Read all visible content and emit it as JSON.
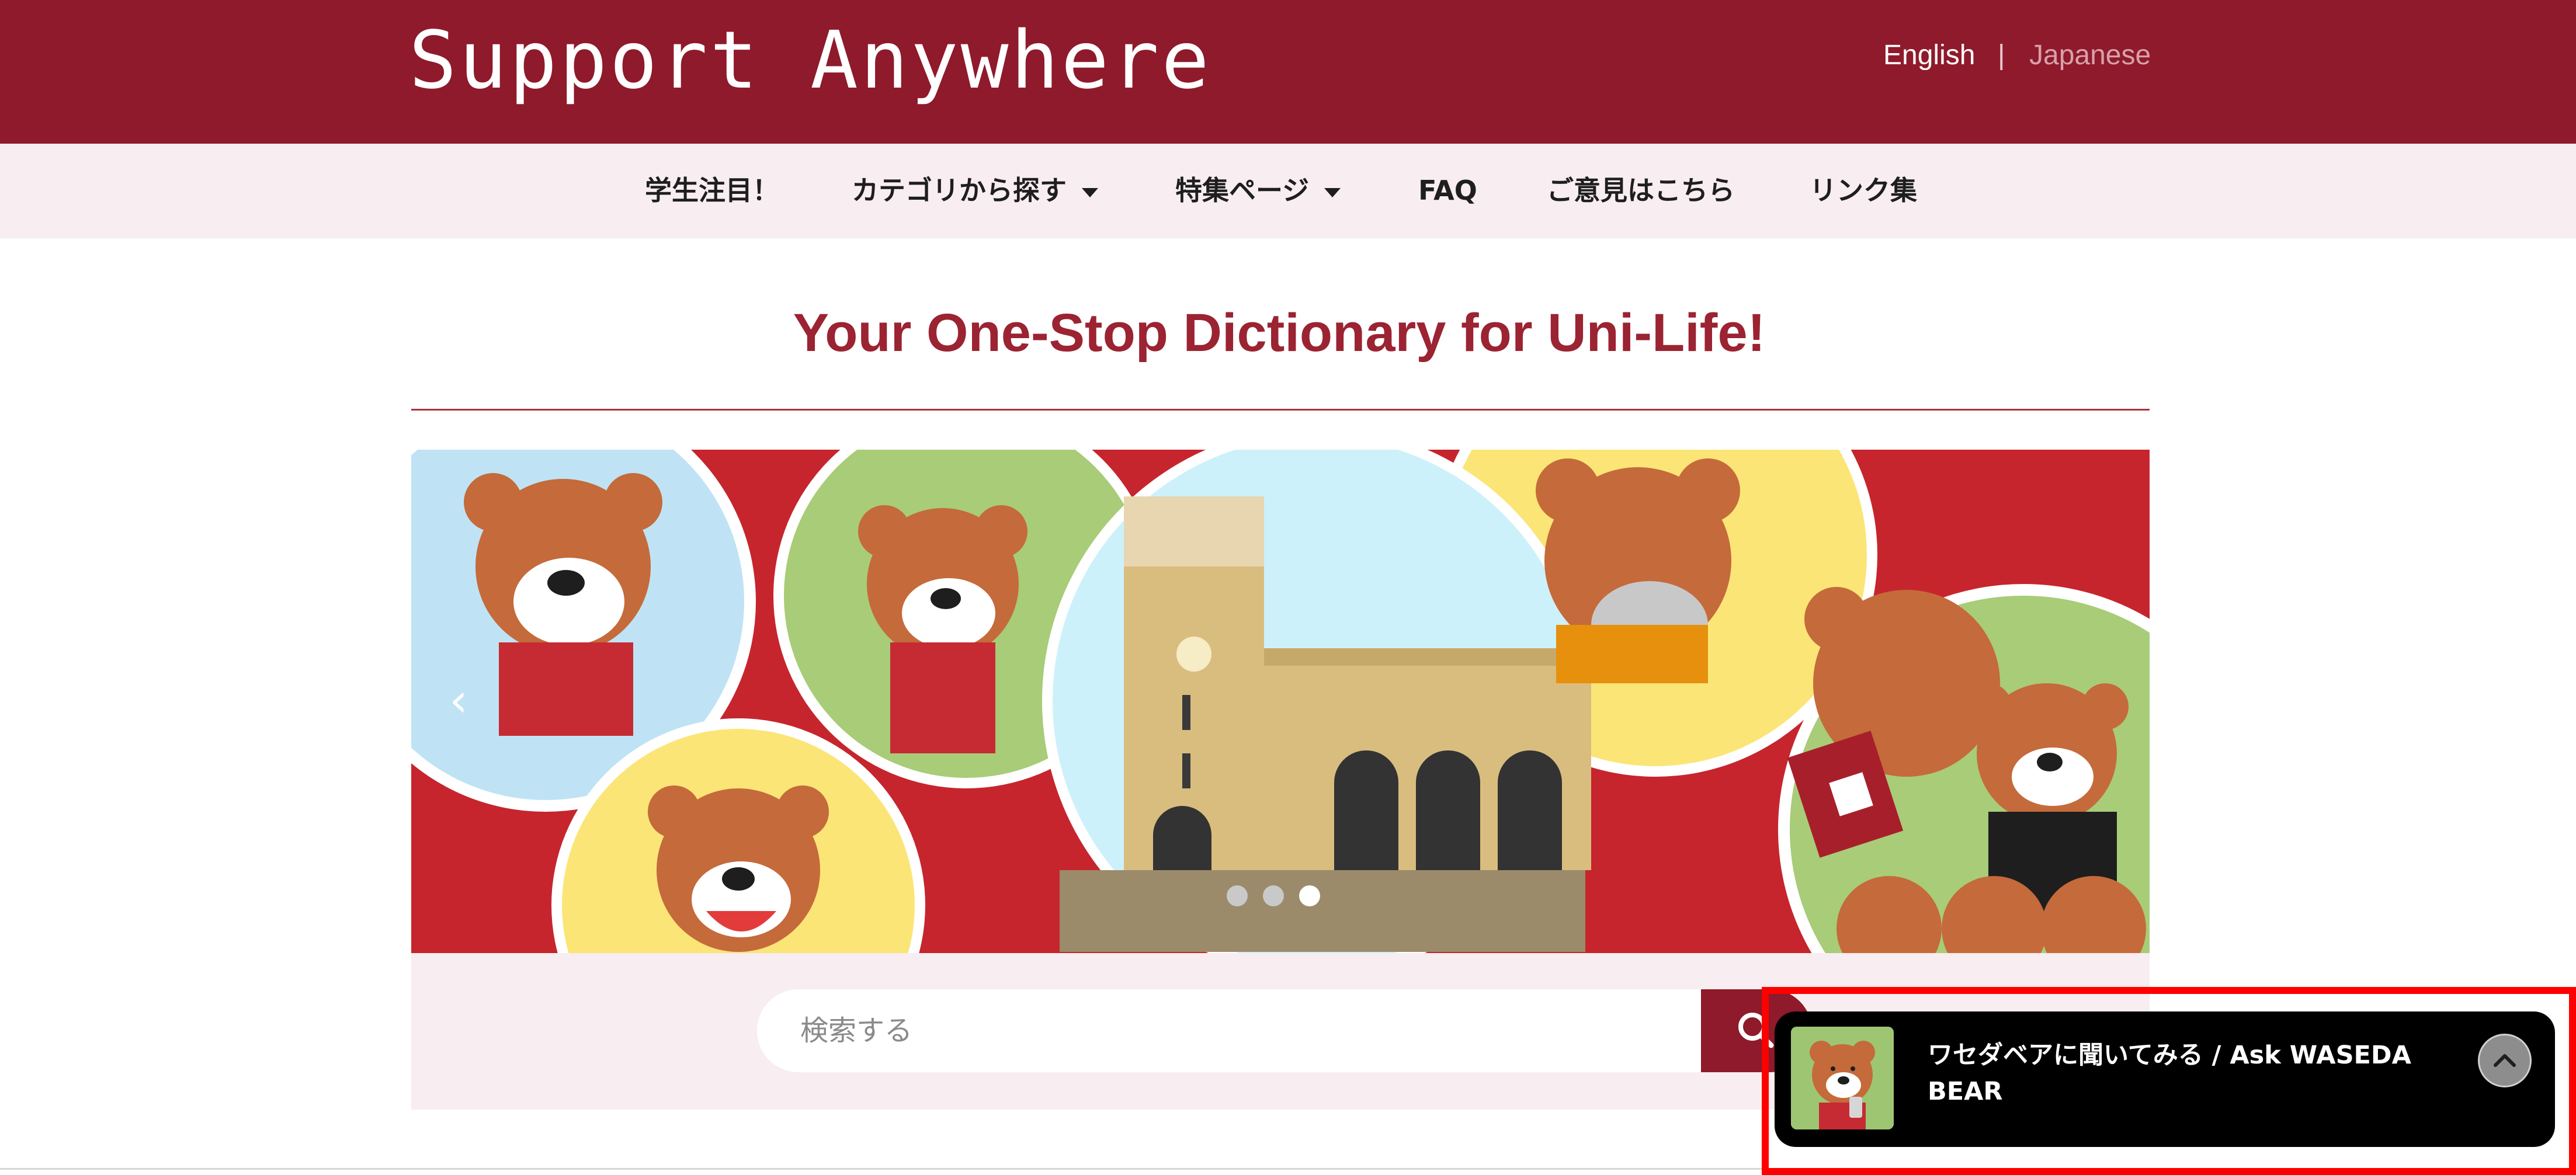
{
  "header": {
    "logo_text": "Support Anywhere",
    "languages": [
      "English",
      "|",
      "Japanese"
    ],
    "active_language": "English"
  },
  "nav": {
    "items": [
      {
        "label": "学生注目！",
        "dropdown": false
      },
      {
        "label": "カテゴリから探す",
        "dropdown": true
      },
      {
        "label": "特集ページ",
        "dropdown": true
      },
      {
        "label": "FAQ",
        "dropdown": false
      },
      {
        "label": "ご意見はこちら",
        "dropdown": false
      },
      {
        "label": "リンク集",
        "dropdown": false
      }
    ]
  },
  "hero": {
    "title": "Your One-Stop Dictionary for Uni-Life!"
  },
  "carousel": {
    "prev_icon": "‹",
    "slide_count": 3,
    "active_slide": 3
  },
  "search": {
    "placeholder": "検索する",
    "value": ""
  },
  "chat": {
    "title": "ワセダベアに聞いてみる / Ask WASEDA BEAR",
    "toggle_icon": "chevron-up-icon"
  },
  "colors": {
    "brand": "#8e1a2b",
    "title": "#9b2332",
    "nav_bg": "#f8edf0",
    "highlight": "#ff0000"
  }
}
